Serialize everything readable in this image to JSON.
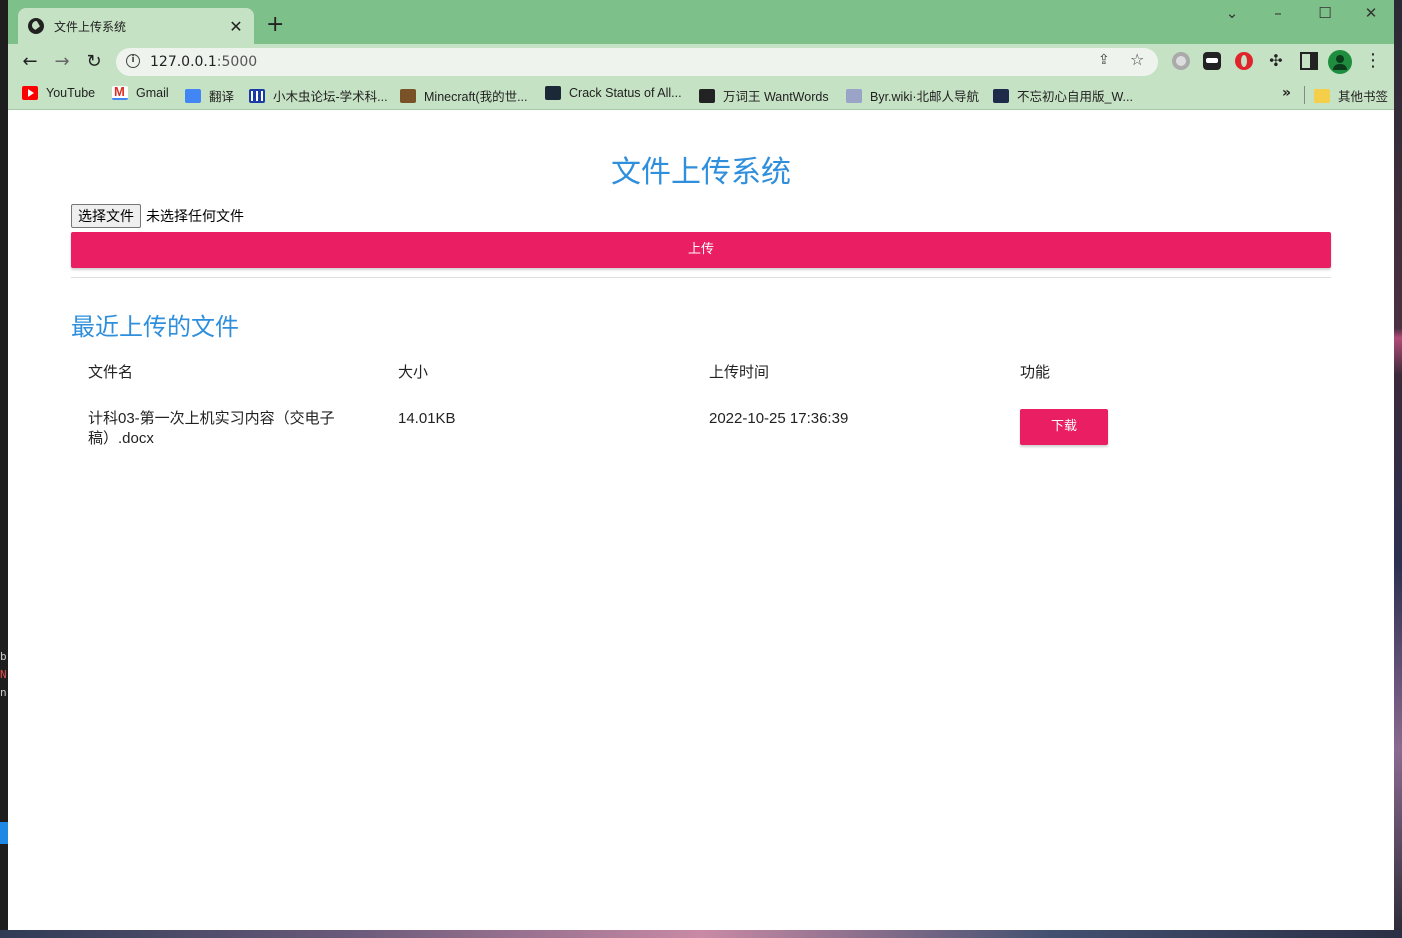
{
  "browser": {
    "tab_title": "文件上传系统",
    "url_host": "127.0.0.1",
    "url_port": ":5000",
    "bookmarks": [
      {
        "label": "YouTube",
        "icon": "youtube-icon"
      },
      {
        "label": "Gmail",
        "icon": "gmail-icon"
      },
      {
        "label": "翻译",
        "icon": "translate-icon"
      },
      {
        "label": "小木虫论坛-学术科...",
        "icon": "forum-icon"
      },
      {
        "label": "Minecraft(我的世...",
        "icon": "minecraft-icon"
      },
      {
        "label": "Crack Status of All...",
        "icon": "steam-icon"
      },
      {
        "label": "万词王 WantWords",
        "icon": "wantwords-icon"
      },
      {
        "label": "Byr.wiki·北邮人导航",
        "icon": "byr-icon"
      },
      {
        "label": "不忘初心自用版_W...",
        "icon": "bw-icon"
      }
    ],
    "other_bookmarks": "其他书签"
  },
  "page": {
    "title": "文件上传系统",
    "choose_file_label": "选择文件",
    "no_file_text": "未选择任何文件",
    "upload_label": "上传",
    "recent_title": "最近上传的文件",
    "table": {
      "headers": [
        "文件名",
        "大小",
        "上传时间",
        "功能"
      ],
      "rows": [
        {
          "name_line1": "计科03-第一次上机实习内容（交电子",
          "name_line2": "稿）.docx",
          "size": "14.01KB",
          "time": "2022-10-25 17:36:39",
          "action": "下载"
        }
      ]
    }
  },
  "colors": {
    "accent": "#e91e63",
    "heading": "#2f8fdc",
    "chrome": "#7ec08a"
  }
}
